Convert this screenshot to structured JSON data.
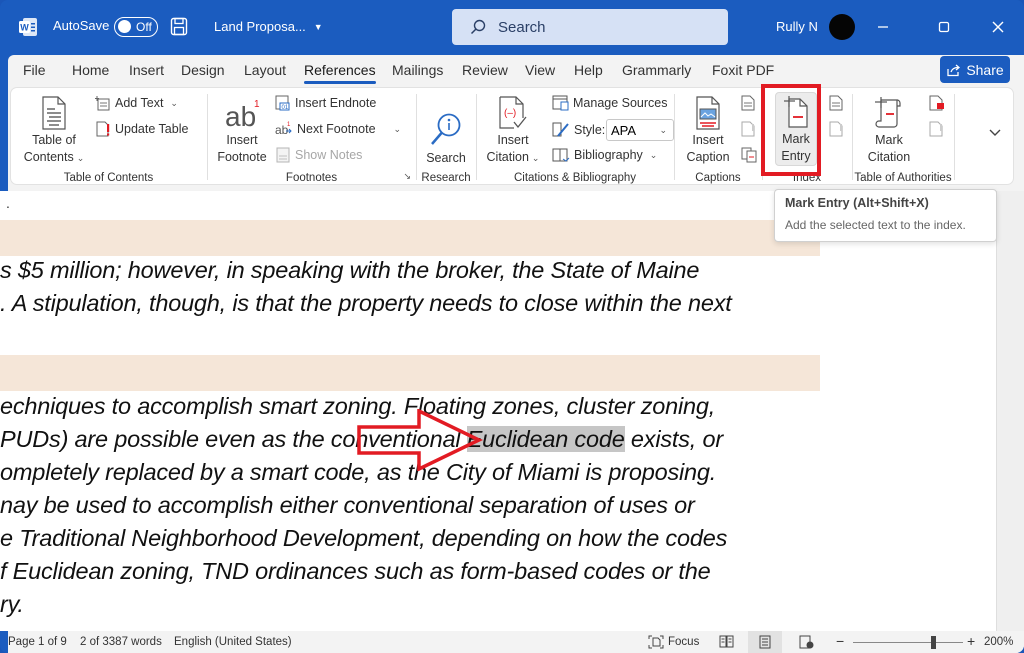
{
  "titlebar": {
    "app_icon": "word-logo-icon",
    "autosave_label": "AutoSave",
    "autosave_state": "Off",
    "document_title": "Land Proposa...",
    "search_placeholder": "Search",
    "user_name": "Rully N",
    "window_controls": [
      "minimize",
      "maximize",
      "close"
    ]
  },
  "tabs": [
    {
      "label": "File"
    },
    {
      "label": "Home"
    },
    {
      "label": "Insert"
    },
    {
      "label": "Design"
    },
    {
      "label": "Layout"
    },
    {
      "label": "References",
      "active": true
    },
    {
      "label": "Mailings"
    },
    {
      "label": "Review"
    },
    {
      "label": "View"
    },
    {
      "label": "Help"
    },
    {
      "label": "Grammarly"
    },
    {
      "label": "Foxit PDF"
    }
  ],
  "share_label": "Share",
  "ribbon": {
    "toc": {
      "label": "Table of Contents",
      "toc_button": [
        "Table of",
        "Contents"
      ],
      "add_text": "Add Text",
      "update_table": "Update Table"
    },
    "footnotes": {
      "label": "Footnotes",
      "insert_footnote": [
        "Insert",
        "Footnote"
      ],
      "insert_endnote": "Insert Endnote",
      "next_footnote": "Next Footnote",
      "show_notes": "Show Notes"
    },
    "research": {
      "label": "Research",
      "search": "Search"
    },
    "citations": {
      "label": "Citations & Bibliography",
      "insert_citation": [
        "Insert",
        "Citation"
      ],
      "manage_sources": "Manage Sources",
      "style_label": "Style:",
      "style_value": "APA",
      "bibliography": "Bibliography"
    },
    "captions": {
      "label": "Captions",
      "insert_caption": [
        "Insert",
        "Caption"
      ]
    },
    "index": {
      "label": "Index",
      "mark_entry": [
        "Mark",
        "Entry"
      ]
    },
    "authorities": {
      "label": "Table of Authorities",
      "mark_citation": [
        "Mark",
        "Citation"
      ]
    }
  },
  "tooltip": {
    "title": "Mark Entry (Alt+Shift+X)",
    "description": "Add the selected text to the index."
  },
  "document": {
    "lines": [
      {
        "text": "s $5 million; however, in speaking with the broker, the State of Maine"
      },
      {
        "text": ". A stipulation, though, is that the property needs to close within the next"
      },
      {
        "text": "echniques to accomplish smart zoning. Floating zones, cluster zoning,"
      },
      {
        "before": "PUDs) are possible even as the conventional ",
        "selected": "Euclidean code",
        "after": " exists, or"
      },
      {
        "text": "ompletely replaced by a smart code, as the City of Miami is proposing."
      },
      {
        "text": "nay be used to accomplish either conventional separation of uses or"
      },
      {
        "text": "e Traditional Neighborhood Development, depending on how the codes"
      },
      {
        "text": "f Euclidean zoning, TND ordinances such as form-based codes or the"
      },
      {
        "text": "ry."
      }
    ],
    "annotation_color": "#e21b23",
    "shading_color": "#f5e6d8"
  },
  "statusbar": {
    "page": "Page 1 of 9",
    "words": "2 of 3387 words",
    "language": "English (United States)",
    "focus": "Focus",
    "zoom": "200%",
    "zoom_minus": "−",
    "zoom_plus": "+"
  }
}
